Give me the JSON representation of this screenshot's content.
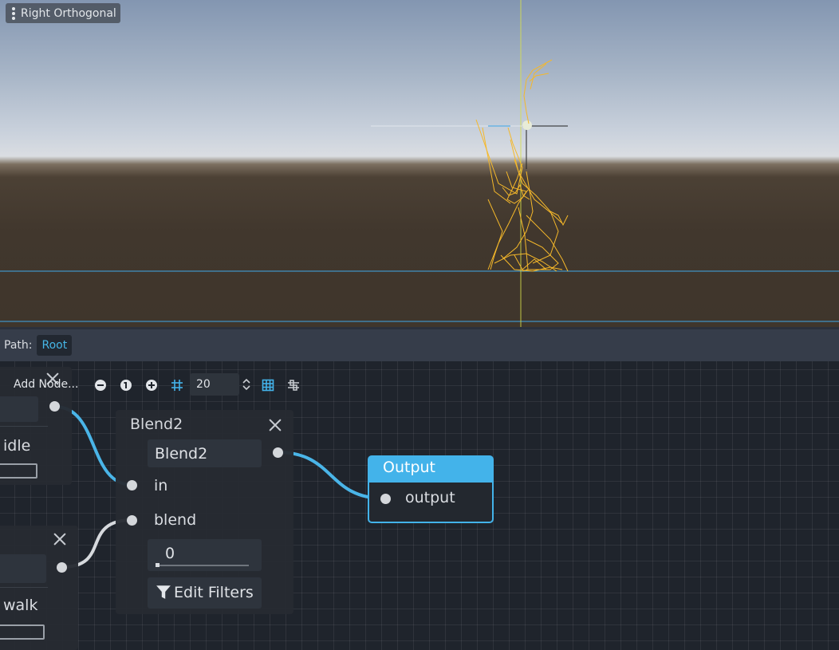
{
  "viewport": {
    "view_menu_label": "Right Orthogonal"
  },
  "path_bar": {
    "label": "Path:",
    "root_button": "Root"
  },
  "toolbar": {
    "add_node_label": "Add Node...",
    "zoom_value": "20",
    "icons": [
      "zoom-out-icon",
      "zoom-reset-icon",
      "zoom-in-icon",
      "snap-grid-icon",
      "grid-toggle-icon",
      "minimap-icon"
    ]
  },
  "nodes": {
    "idle": {
      "label": "idle"
    },
    "walk": {
      "label": "walk"
    },
    "blend2": {
      "title": "Blend2",
      "name_value": "Blend2",
      "port_in": "in",
      "port_blend": "blend",
      "blend_value": "0",
      "blend_amount": 0,
      "filters_button": "Edit Filters"
    },
    "output": {
      "title": "Output",
      "port_output": "output"
    }
  },
  "colors": {
    "accent": "#43b3ea",
    "connection": "#4ab5e8",
    "skeleton": "#f5b82a",
    "graph_bg": "#1f242c"
  }
}
